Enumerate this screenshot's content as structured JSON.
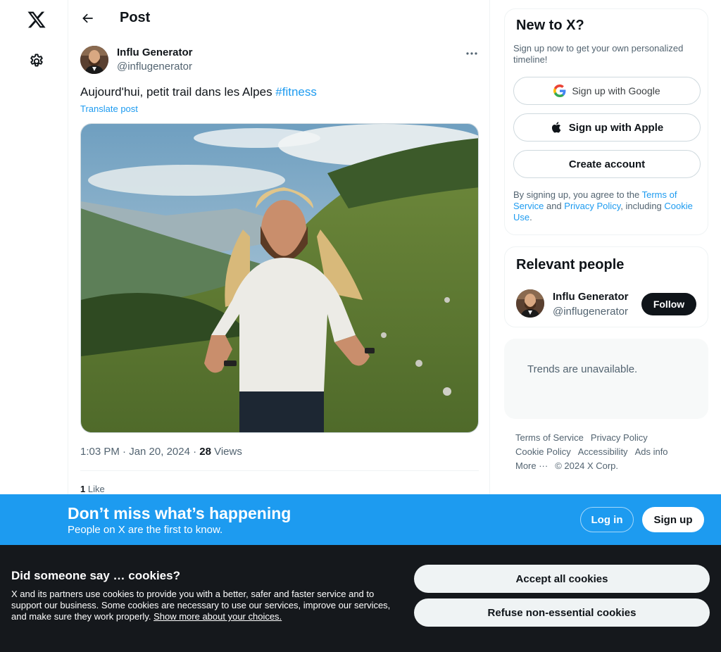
{
  "colors": {
    "accent": "#1d9bf0",
    "text": "#0f1419",
    "secondary": "#536471",
    "cookie_bg": "#15181c"
  },
  "nav": {
    "logo_icon": "x-logo-icon",
    "settings_icon": "gear-icon"
  },
  "header": {
    "title": "Post",
    "back_icon": "arrow-left-icon"
  },
  "post": {
    "author_name": "Influ Generator",
    "author_handle": "@influgenerator",
    "text": "Aujourd'hui, petit trail dans les Alpes ",
    "hashtag": "#fitness",
    "translate": "Translate post",
    "time": "1:03 PM · Jan 20, 2024 · ",
    "views_count": "28",
    "views_label": " Views",
    "likes_count": "1",
    "likes_label": " Like"
  },
  "signup_card": {
    "title": "New to X?",
    "subtitle": "Sign up now to get your own personalized timeline!",
    "google": "Sign up with Google",
    "apple": "Sign up with Apple",
    "create": "Create account",
    "terms_prefix": "By signing up, you agree to the ",
    "terms_link": "Terms of Service",
    "terms_and": " and ",
    "privacy_link": "Privacy Policy",
    "terms_including": ", including ",
    "cookie_link": "Cookie Use",
    "terms_end": "."
  },
  "relevant": {
    "title": "Relevant people",
    "name": "Influ Generator",
    "handle": "@influgenerator",
    "follow": "Follow"
  },
  "trends": {
    "message": "Trends are unavailable."
  },
  "footer": {
    "terms": "Terms of Service",
    "privacy": "Privacy Policy",
    "cookie": "Cookie Policy",
    "accessibility": "Accessibility",
    "ads": "Ads info",
    "more": "More ···",
    "copyright": "© 2024 X Corp."
  },
  "banner": {
    "title": "Don’t miss what’s happening",
    "subtitle": "People on X are the first to know.",
    "login": "Log in",
    "signup": "Sign up"
  },
  "cookies": {
    "title": "Did someone say … cookies?",
    "text": "X and its partners use cookies to provide you with a better, safer and faster service and to support our business. Some cookies are necessary to use our services, improve our services, and make sure they work properly. ",
    "link": "Show more about your choices.",
    "accept": "Accept all cookies",
    "refuse": "Refuse non-essential cookies"
  }
}
